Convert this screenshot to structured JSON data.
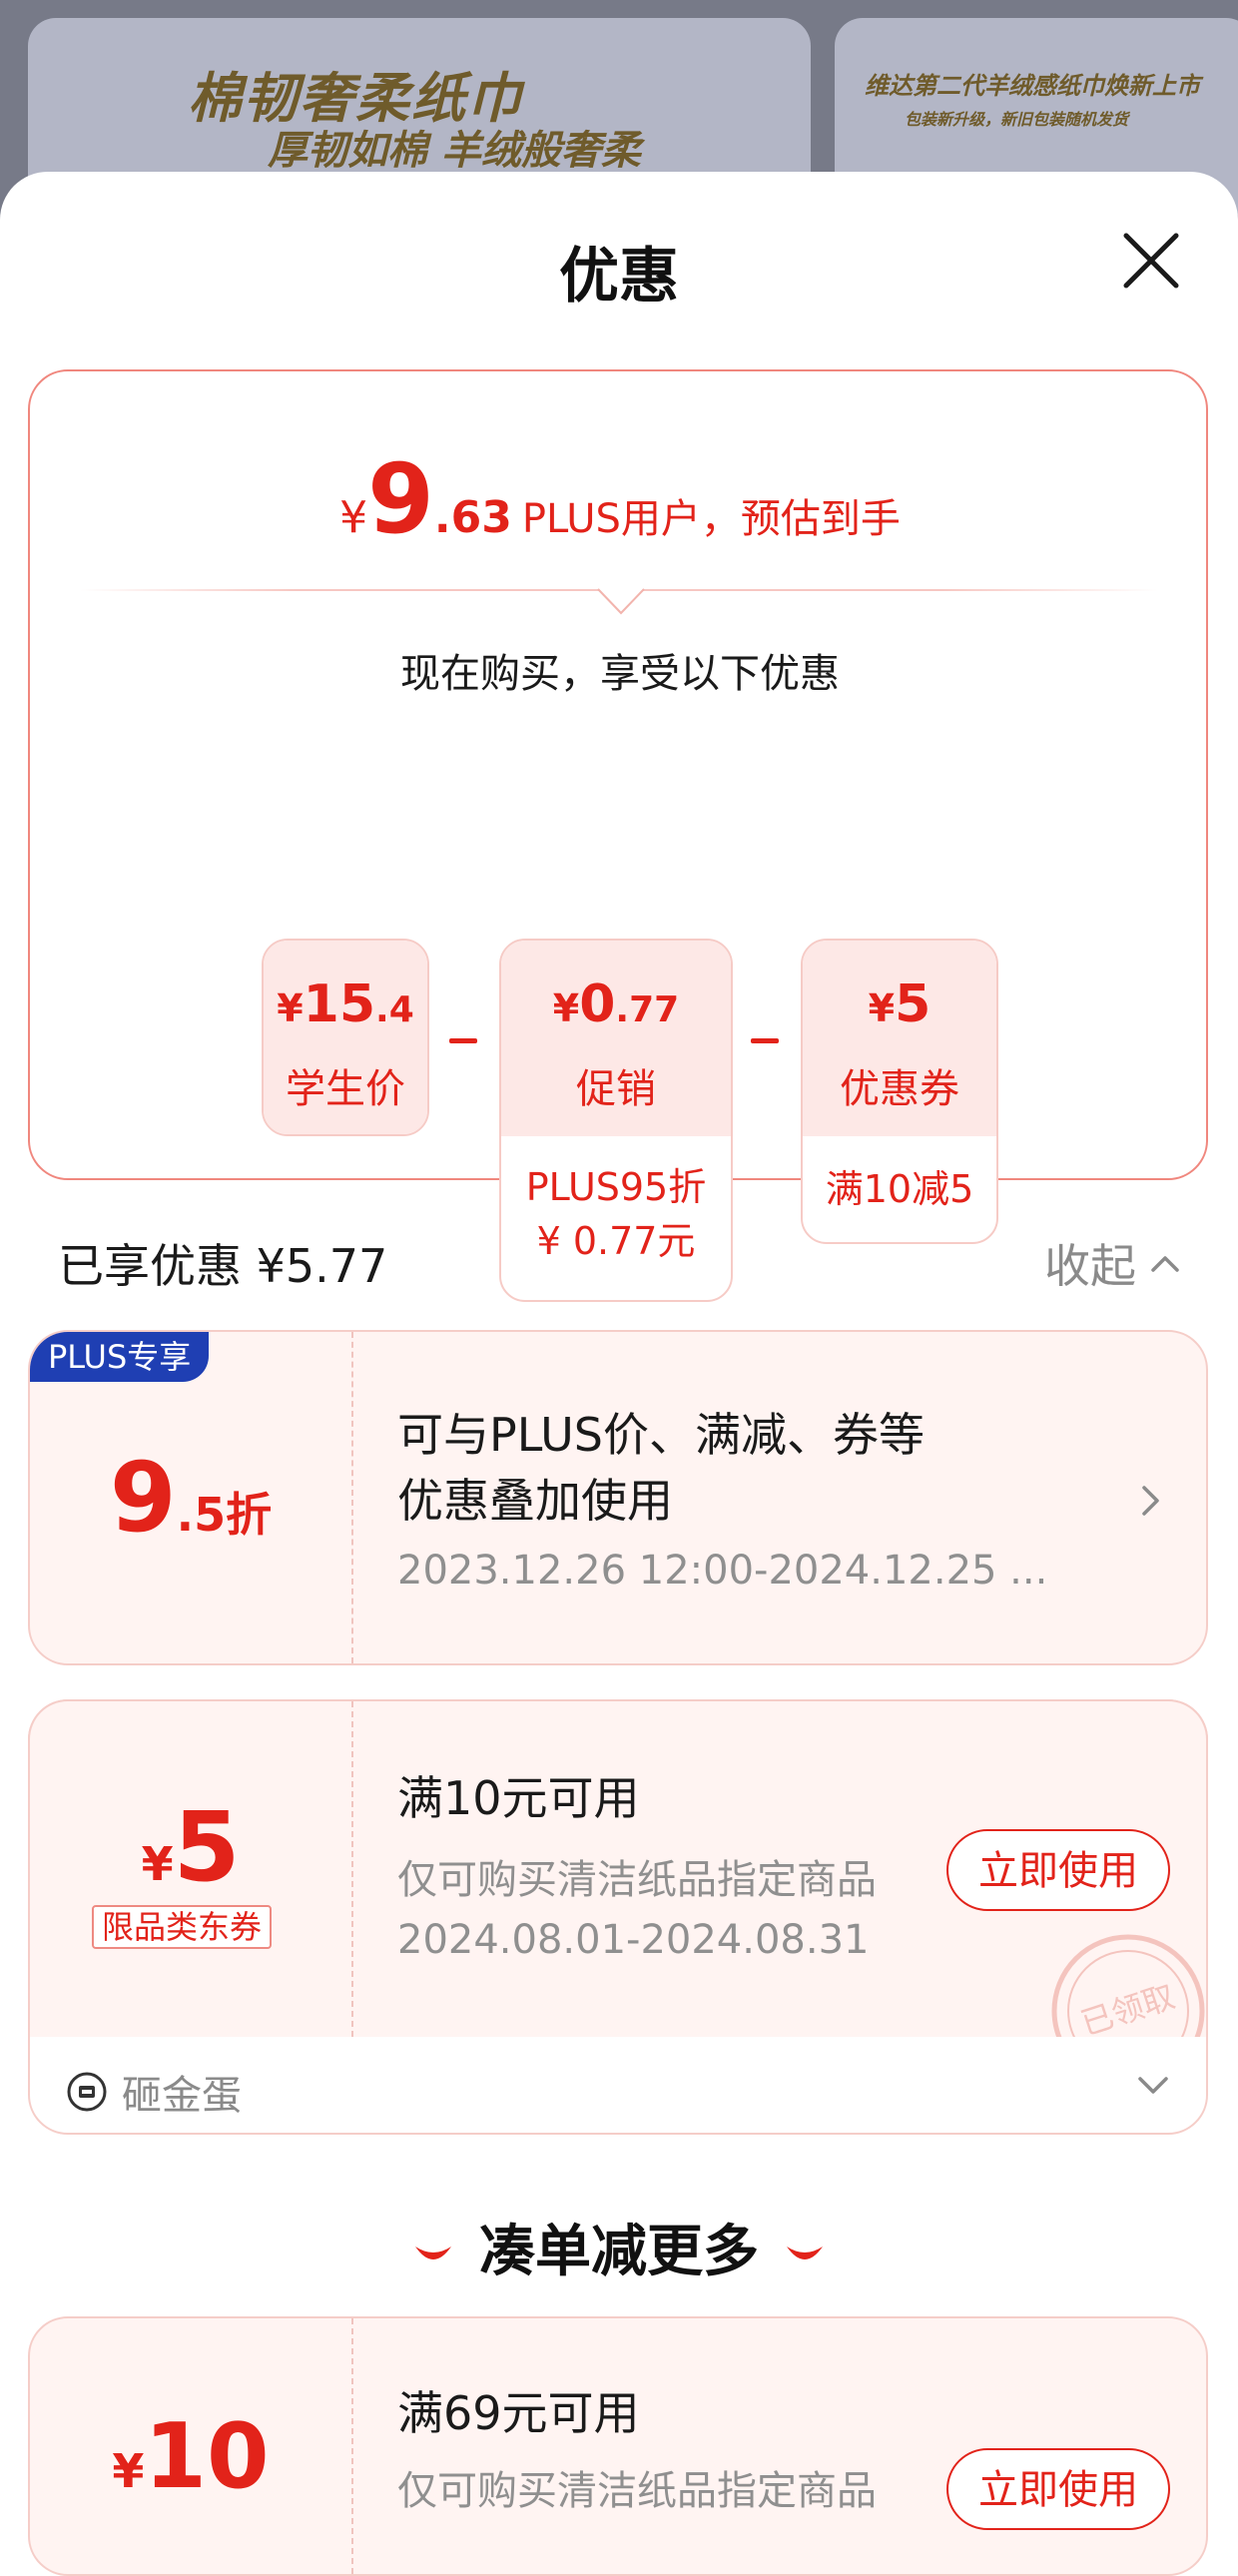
{
  "background": {
    "banner_left": {
      "line1": "棉韧奢柔纸巾",
      "line2": "厚韧如棉 羊绒般奢柔"
    },
    "banner_right": {
      "line1": "维达第二代羊绒感纸巾焕新上市",
      "line2": "包装新升级，新旧包装随机发货"
    }
  },
  "sheet": {
    "title": "优惠"
  },
  "summary": {
    "currency": "¥",
    "price_int": "9",
    "price_dec": ".63",
    "price_label": "PLUS用户，预估到手",
    "now_text": "现在购买，享受以下优惠",
    "chips": [
      {
        "currency": "¥",
        "int": "15",
        "dec": ".4",
        "label": "学生价"
      },
      {
        "currency": "¥",
        "int": "0",
        "dec": ".77",
        "label": "促销",
        "detail1": "PLUS95折",
        "detail2": "¥ 0.77元"
      },
      {
        "currency": "¥",
        "int": "5",
        "dec": "",
        "label": "优惠券",
        "detail1": "满10减5"
      }
    ]
  },
  "enjoyed": {
    "text": "已享优惠 ¥5.77",
    "collapse_label": "收起"
  },
  "coupons": [
    {
      "badge": "PLUS专享",
      "amount_int": "9",
      "amount_dec": ".5折",
      "title_line1": "可与PLUS价、满减、券等",
      "title_line2": "优惠叠加使用",
      "validity": "2023.12.26 12:00-2024.12.25 ..."
    },
    {
      "currency": "¥",
      "amount": "5",
      "tag": "限品类东券",
      "title": "满10元可用",
      "desc": "仅可购买清洁纸品指定商品",
      "validity": "2024.08.01-2024.08.31",
      "action": "立即使用",
      "stamp": "已领取",
      "footer": "砸金蛋"
    },
    {
      "currency": "¥",
      "amount": "10",
      "title": "满69元可用",
      "desc": "仅可购买清洁纸品指定商品",
      "action": "立即使用"
    }
  ],
  "more": {
    "title": "凑单减更多"
  },
  "colors": {
    "accent": "#e2231a",
    "plus_badge": "#1f3fb3",
    "chip_bg": "#fde8e6"
  }
}
